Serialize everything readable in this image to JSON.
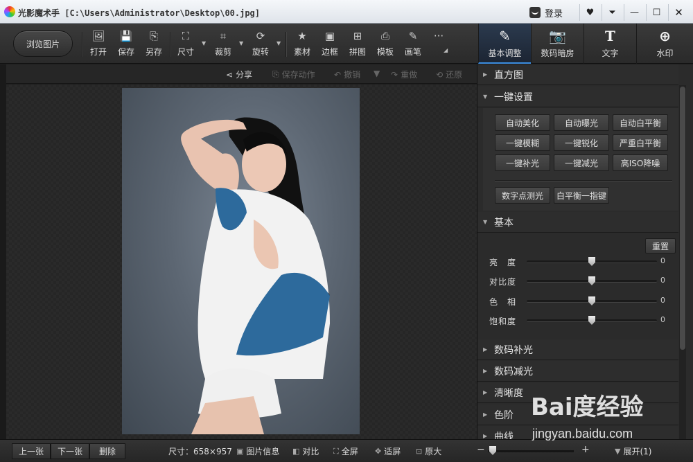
{
  "window": {
    "app_name": "光影魔术手",
    "path": "[C:\\Users\\Administrator\\Desktop\\00.jpg]",
    "login_label": "登录"
  },
  "toolbar": {
    "browse_label": "浏览图片",
    "tools": [
      {
        "label": "打开",
        "icon": "open-icon"
      },
      {
        "label": "保存",
        "icon": "save-icon"
      },
      {
        "label": "另存",
        "icon": "save-as-icon"
      },
      {
        "label": "尺寸",
        "icon": "resize-icon"
      },
      {
        "label": "裁剪",
        "icon": "crop-icon"
      },
      {
        "label": "旋转",
        "icon": "rotate-icon"
      },
      {
        "label": "素材",
        "icon": "material-icon"
      },
      {
        "label": "边框",
        "icon": "border-icon"
      },
      {
        "label": "拼图",
        "icon": "collage-icon"
      },
      {
        "label": "模板",
        "icon": "template-icon"
      },
      {
        "label": "画笔",
        "icon": "brush-icon"
      }
    ],
    "more_label": "···",
    "right_tabs": [
      {
        "label": "基本调整",
        "icon": "edit-icon",
        "active": true
      },
      {
        "label": "数码暗房",
        "icon": "camera-icon",
        "active": false
      },
      {
        "label": "文字",
        "icon": "text-icon",
        "active": false
      },
      {
        "label": "水印",
        "icon": "watermark-icon",
        "active": false
      }
    ]
  },
  "subbar": {
    "share": "分享",
    "save_action": "保存动作",
    "undo": "撤销",
    "redo": "重做",
    "restore": "还原"
  },
  "panel": {
    "histogram": "直方图",
    "one_click": "一键设置",
    "presets": [
      [
        "自动美化",
        "自动曝光",
        "自动白平衡"
      ],
      [
        "一键模糊",
        "一键锐化",
        "严重白平衡"
      ],
      [
        "一键补光",
        "一键减光",
        "高ISO降噪"
      ]
    ],
    "extra_presets": [
      "数字点测光",
      "白平衡一指键"
    ],
    "basic": "基本",
    "reset": "重置",
    "sliders": [
      {
        "label": "亮　度",
        "value": "0",
        "level": 0.5
      },
      {
        "label": "对比度",
        "value": "0",
        "level": 0.5
      },
      {
        "label": "色　相",
        "value": "0",
        "level": 0.5
      },
      {
        "label": "饱和度",
        "value": "0",
        "level": 0.5
      }
    ],
    "collapsed_sections": [
      "数码补光",
      "数码减光",
      "清晰度",
      "色阶",
      "曲线"
    ]
  },
  "bottombar": {
    "prev": "上一张",
    "next": "下一张",
    "delete": "删除",
    "size": "尺寸：658×957",
    "info": "图片信息",
    "compare": "对比",
    "fullscreen": "全屏",
    "fit": "适屏",
    "original": "原大",
    "zoom_minus": "−",
    "zoom_plus": "+",
    "expand": "展开(1)"
  },
  "watermark": {
    "logo": "Bai度经验",
    "url": "jingyan.baidu.com"
  },
  "colors": {
    "accent": "#3c8ee0",
    "background": "#1f1f1f",
    "panel": "#2b2b2b"
  }
}
